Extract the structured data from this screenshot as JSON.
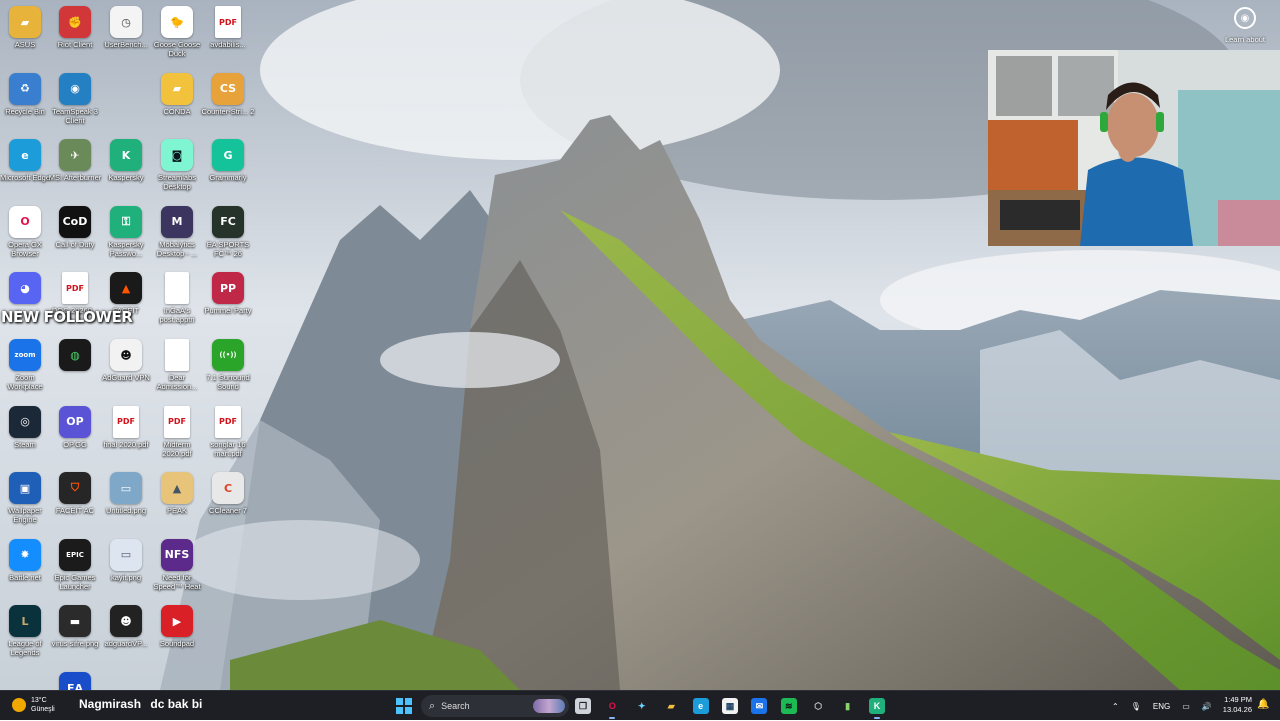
{
  "desktop": {
    "columns": [
      [
        {
          "label": "ASUS",
          "icon": "folder-icon",
          "color": "#e8b33a",
          "glyph": "▰"
        },
        {
          "label": "Recycle Bin",
          "icon": "recycle-bin-icon",
          "color": "#3a7fcf",
          "glyph": "♻"
        },
        {
          "label": "Microsoft Edge",
          "icon": "edge-icon",
          "color": "#1c9dd9",
          "glyph": "e"
        },
        {
          "label": "Opera GX Browser",
          "icon": "opera-gx-icon",
          "color": "#ffffff",
          "glyph": "O",
          "fg": "#e0124a"
        },
        {
          "label": "",
          "icon": "discord-icon",
          "color": "#5865f2",
          "glyph": "◕"
        },
        {
          "label": "Zoom Workplace",
          "icon": "zoom-icon",
          "color": "#1a73e8",
          "glyph": "zoom"
        },
        {
          "label": "Steam",
          "icon": "steam-icon",
          "color": "#1b2838",
          "glyph": "◎"
        },
        {
          "label": "Wallpaper Engine",
          "icon": "wallpaper-engine-icon",
          "color": "#1f5fb8",
          "glyph": "▣"
        },
        {
          "label": "Battle.net",
          "icon": "battlenet-icon",
          "color": "#148eff",
          "glyph": "✸"
        },
        {
          "label": "League of Legends",
          "icon": "league-icon",
          "color": "#0a323c",
          "glyph": "L",
          "fg": "#c8aa6e"
        }
      ],
      [
        {
          "label": "Riot Client",
          "icon": "riot-client-icon",
          "color": "#d13639",
          "glyph": "✊"
        },
        {
          "label": "TeamSpeak 3 Client",
          "icon": "teamspeak-icon",
          "color": "#2580c3",
          "glyph": "◉"
        },
        {
          "label": "MSI Afterburner",
          "icon": "msi-afterburner-icon",
          "color": "#6a8a5a",
          "glyph": "✈"
        },
        {
          "label": "Call of Duty",
          "icon": "call-of-duty-icon",
          "color": "#111111",
          "glyph": "CoD"
        },
        {
          "label": "DOC-20260...",
          "icon": "pdf-icon",
          "type": "pdf"
        },
        {
          "label": "",
          "icon": "fortinet-icon",
          "color": "#1a1a1a",
          "glyph": "◍",
          "fg": "#4fd16b"
        },
        {
          "label": "OP.GG",
          "icon": "opgg-icon",
          "color": "#5b53d6",
          "glyph": "OP"
        },
        {
          "label": "FACEIT AC",
          "icon": "faceit-ac-icon",
          "color": "#262626",
          "glyph": "⛉",
          "fg": "#ff5500"
        },
        {
          "label": "Epic Games Launcher",
          "icon": "epic-games-icon",
          "color": "#1b1b1b",
          "glyph": "EPIC"
        },
        {
          "label": "virus sifre.png",
          "icon": "image-file-icon",
          "color": "#2b2b2b",
          "glyph": "▬"
        },
        {
          "label": "EA",
          "icon": "ea-icon",
          "color": "#1a4dc9",
          "glyph": "EA"
        }
      ],
      [
        {
          "label": "UserBench...",
          "icon": "userbenchmark-icon",
          "color": "#f4f4f4",
          "glyph": "◷",
          "fg": "#444"
        },
        {
          "label": "MSI Afterburner",
          "icon": "msi-icon",
          "color": "#1f1f1f",
          "glyph": "",
          "hidden": true
        },
        {
          "label": "Kaspersky",
          "icon": "kaspersky-icon",
          "color": "#1fb07c",
          "glyph": "K"
        },
        {
          "label": "Kaspersky Passwo...",
          "icon": "kaspersky-password-icon",
          "color": "#1fb07c",
          "glyph": "⚿"
        },
        {
          "label": "FACEIT",
          "icon": "faceit-icon",
          "color": "#1a1a1a",
          "glyph": "▲",
          "fg": "#ff5500"
        },
        {
          "label": "AdGuard VPN",
          "icon": "adguard-vpn-icon",
          "color": "#f2f2f2",
          "glyph": "☻",
          "fg": "#111"
        },
        {
          "label": "final 2020.pdf",
          "icon": "pdf-icon",
          "type": "pdf"
        },
        {
          "label": "Untitled.png",
          "icon": "image-file-icon",
          "color": "#7fa8c8",
          "glyph": "▭"
        },
        {
          "label": "kayit.png",
          "icon": "image-file-icon",
          "color": "#dde6f0",
          "glyph": "▭",
          "fg": "#557"
        },
        {
          "label": "adguardVP...",
          "icon": "adguard-icon",
          "color": "#222",
          "glyph": "☻"
        }
      ],
      [
        {
          "label": "Goose Goose Duck",
          "icon": "goose-goose-duck-icon",
          "color": "#ffffff",
          "glyph": "🐤",
          "fg": "#333"
        },
        {
          "label": "CONDA",
          "icon": "folder-icon",
          "color": "#f3c23c",
          "glyph": "▰"
        },
        {
          "label": "Streamlabs Desktop",
          "icon": "streamlabs-icon",
          "color": "#80f5d2",
          "glyph": "◙",
          "fg": "#09161d"
        },
        {
          "label": "Mobalytics Desktop - ...",
          "icon": "mobalytics-icon",
          "color": "#3b3560",
          "glyph": "M"
        },
        {
          "label": "InGaA's post.apptri",
          "icon": "document-icon",
          "type": "doc"
        },
        {
          "label": "Dear Admission...",
          "icon": "document-icon",
          "type": "doc"
        },
        {
          "label": "Midterm 2020.pdf",
          "icon": "pdf-icon",
          "type": "pdf"
        },
        {
          "label": "PEAK",
          "icon": "peak-icon",
          "color": "#e8c47a",
          "glyph": "▲",
          "fg": "#456"
        },
        {
          "label": "Need for Speed™ Heat",
          "icon": "nfs-heat-icon",
          "color": "#5b2a8a",
          "glyph": "NFS"
        },
        {
          "label": "Soundpad",
          "icon": "soundpad-icon",
          "color": "#d92027",
          "glyph": "▶"
        }
      ],
      [
        {
          "label": "avdabilis...",
          "icon": "pdf-icon",
          "type": "pdf"
        },
        {
          "label": "Counter-Stri... 2",
          "icon": "cs2-icon",
          "color": "#e7a23a",
          "glyph": "CS"
        },
        {
          "label": "Grammarly",
          "icon": "grammarly-icon",
          "color": "#15c39a",
          "glyph": "G"
        },
        {
          "label": "EA SPORTS FC™ 26",
          "icon": "ea-fc-icon",
          "color": "#25332a",
          "glyph": "FC"
        },
        {
          "label": "Pummel Party",
          "icon": "pummel-party-icon",
          "color": "#c02848",
          "glyph": "PP"
        },
        {
          "label": "7.1 Surround Sound",
          "icon": "surround-sound-icon",
          "color": "#2aa52a",
          "glyph": "((•))"
        },
        {
          "label": "songlar 16 mart.pdf",
          "icon": "pdf-icon",
          "type": "pdf"
        },
        {
          "label": "CCleaner 7",
          "icon": "ccleaner-icon",
          "color": "#e8e8e8",
          "glyph": "C",
          "fg": "#d42"
        }
      ]
    ]
  },
  "overlay": {
    "follower_text": "NEW FOLLOWER"
  },
  "learn": {
    "label": "Learn about"
  },
  "taskbar": {
    "weather_temp": "13°C",
    "weather_desc": "Güneşli",
    "chat_user": "Nagmirash",
    "chat_msg": "dc bak bi",
    "search_placeholder": "Search",
    "language": "ENG",
    "time": "1:49 PM",
    "date": "13.04.26",
    "apps": [
      {
        "name": "taskview-icon",
        "glyph": "❐",
        "color": "#cfd3da",
        "fg": "#222"
      },
      {
        "name": "opera-gx-taskbar-icon",
        "glyph": "O",
        "color": "transparent",
        "fg": "#e0124a",
        "active": true
      },
      {
        "name": "copilot-icon",
        "glyph": "✦",
        "color": "transparent",
        "fg": "#6bd1ff"
      },
      {
        "name": "file-explorer-icon",
        "glyph": "▰",
        "color": "transparent",
        "fg": "#f3c23c"
      },
      {
        "name": "edge-taskbar-icon",
        "glyph": "e",
        "color": "#1c9dd9",
        "fg": "#fff"
      },
      {
        "name": "store-icon",
        "glyph": "▦",
        "color": "#f2f2f2",
        "fg": "#246"
      },
      {
        "name": "outlook-icon",
        "glyph": "✉",
        "color": "#1a73e8",
        "fg": "#fff"
      },
      {
        "name": "spotify-icon",
        "glyph": "≋",
        "color": "#1db954",
        "fg": "#111"
      },
      {
        "name": "app-shield-icon",
        "glyph": "⬡",
        "color": "transparent",
        "fg": "#ccc"
      },
      {
        "name": "sticky-notes-icon",
        "glyph": "▮",
        "color": "transparent",
        "fg": "#8bd36c"
      },
      {
        "name": "kaspersky-taskbar-icon",
        "glyph": "K",
        "color": "#1fb07c",
        "fg": "#fff",
        "active": true
      }
    ]
  }
}
